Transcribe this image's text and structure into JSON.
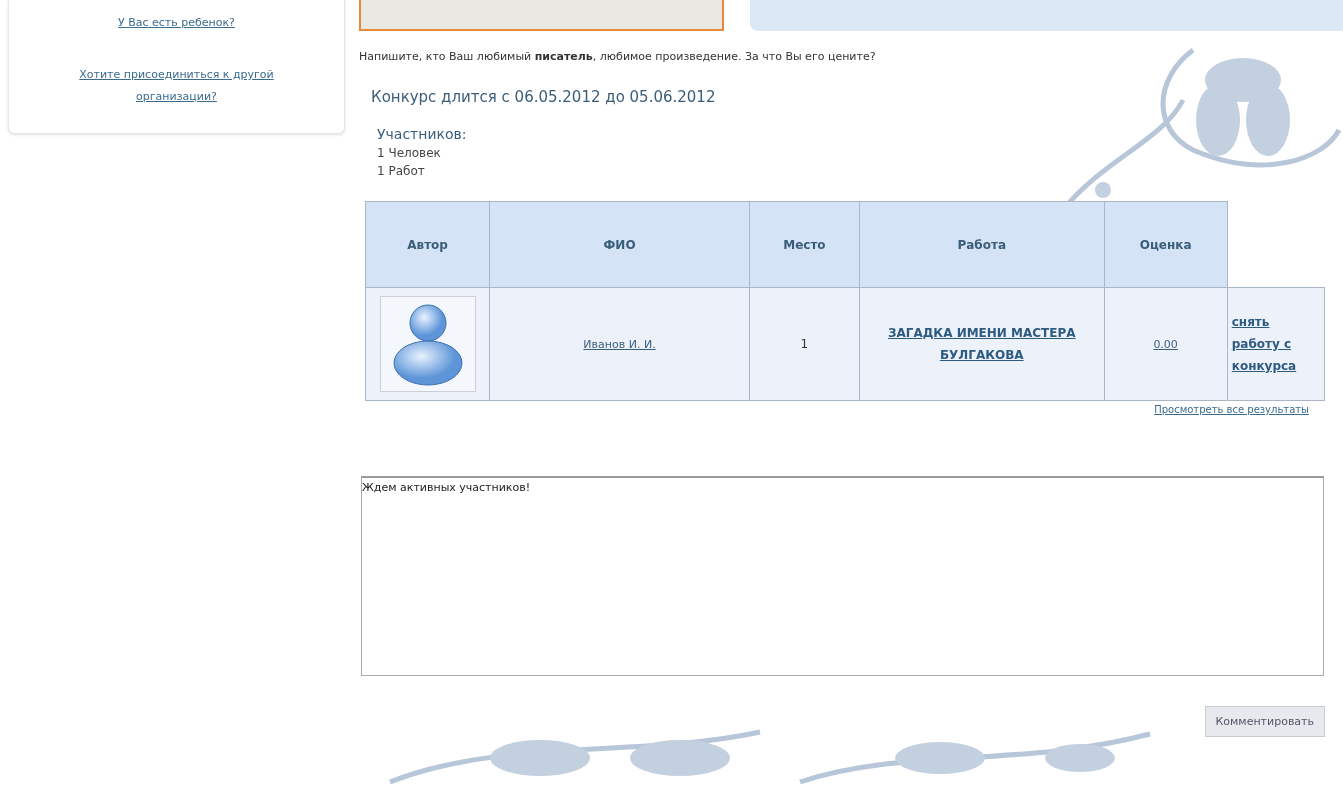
{
  "sidebar": {
    "links": [
      "У Вас есть ребенок?",
      "Хотите присоединиться к другой организации?"
    ]
  },
  "prompt": "Напишите, кто Ваш любимый **писатель**, любимое произведение. За что Вы его цените?",
  "contest_dates": "Конкурс длится с 06.05.2012 до 05.06.2012",
  "participants": {
    "title": "Участников:",
    "lines": [
      "1 Человек",
      "1 Работ"
    ]
  },
  "table": {
    "columns": [
      "Автор",
      "ФИО",
      "Место",
      "Работа",
      "Оценка"
    ],
    "rows": [
      {
        "name": "Иванов И. И.",
        "place": "1",
        "work": "ЗАГАДКА ИМЕНИ МАСТЕРА БУЛГАКОВА",
        "score": "0.00",
        "action": "снять работу с конкурса"
      }
    ]
  },
  "all_results_link": "Просмотреть все результаты",
  "comment": {
    "value": "Ждем активных участников!"
  },
  "submit_button": "Комментировать"
}
